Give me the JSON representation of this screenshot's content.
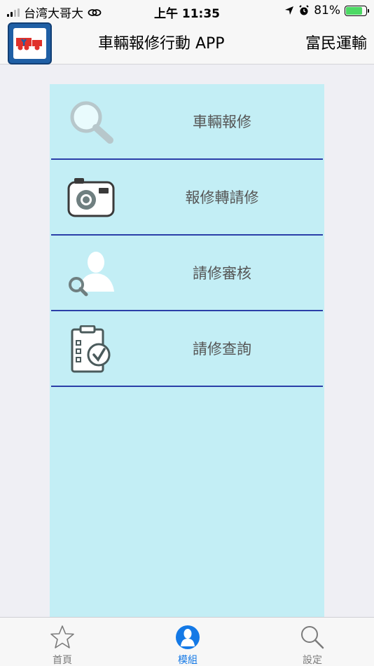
{
  "status_bar": {
    "carrier": "台湾大哥大",
    "time": "上午 11:35",
    "battery": "81%",
    "icons": [
      "signal-icon",
      "link-icon",
      "location-icon",
      "alarm-icon",
      "battery-charging-icon"
    ]
  },
  "header": {
    "title": "車輛報修行動 APP",
    "company": "富民運輸"
  },
  "menu": {
    "items": [
      {
        "label": "車輛報修",
        "icon": "search-icon"
      },
      {
        "label": "報修轉請修",
        "icon": "camera-icon"
      },
      {
        "label": "請修審核",
        "icon": "user-search-icon"
      },
      {
        "label": "請修查詢",
        "icon": "clipboard-check-icon"
      }
    ]
  },
  "tabbar": {
    "tabs": [
      {
        "label": "首頁",
        "icon": "star-icon",
        "active": false
      },
      {
        "label": "模組",
        "icon": "person-icon",
        "active": true
      },
      {
        "label": "設定",
        "icon": "search-icon",
        "active": false
      }
    ]
  },
  "colors": {
    "panel": "#c3eef5",
    "divider": "#2b3fa8",
    "active_tab": "#1479e6",
    "inactive_tab": "#7b7b7b"
  }
}
